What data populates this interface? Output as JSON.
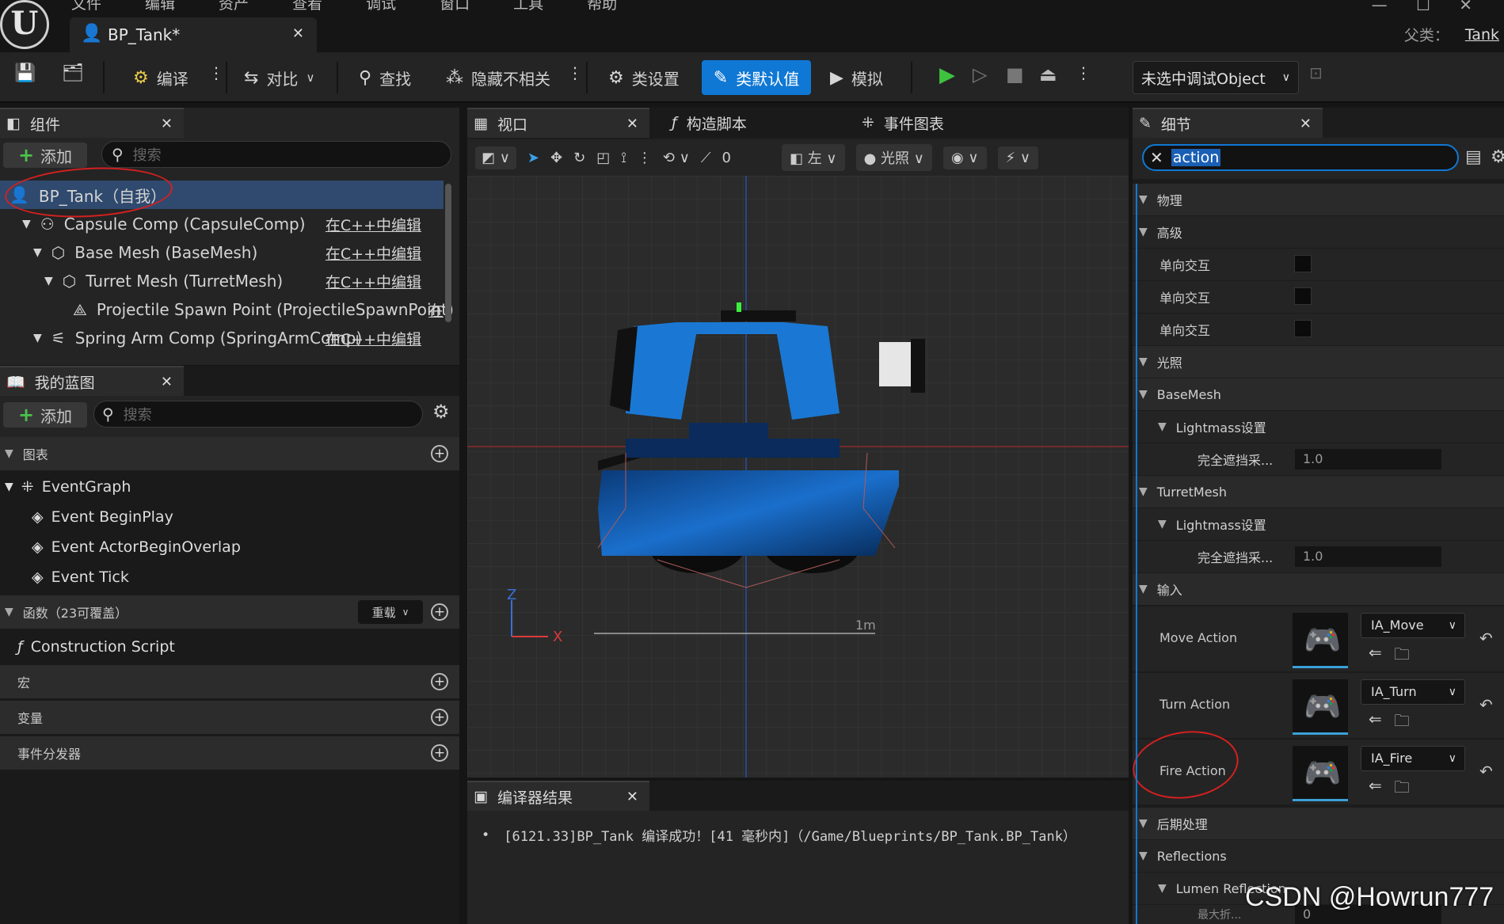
{
  "menu": [
    "文件",
    "编辑",
    "资产",
    "查看",
    "调试",
    "窗口",
    "工具",
    "帮助"
  ],
  "doc_tab": {
    "title": "BP_Tank*"
  },
  "parent": {
    "label": "父类：",
    "value": "Tank"
  },
  "toolbar": {
    "compile": "编译",
    "diff": "对比",
    "find": "查找",
    "hide_unrelated": "隐藏不相关",
    "class_settings": "类设置",
    "class_defaults": "类默认值",
    "simulate": "模拟",
    "debug_object": "未选中调试Object"
  },
  "components": {
    "tab": "组件",
    "add": "添加",
    "search_placeholder": "搜索",
    "tree": [
      {
        "label": "BP_Tank（自我）",
        "edit": ""
      },
      {
        "label": "Capsule Comp (CapsuleComp)",
        "edit": "在C++中编辑"
      },
      {
        "label": "Base Mesh (BaseMesh)",
        "edit": "在C++中编辑"
      },
      {
        "label": "Turret Mesh (TurretMesh)",
        "edit": "在C++中编辑"
      },
      {
        "label": "Projectile Spawn Point (ProjectileSpawnPoint)",
        "edit": "在"
      },
      {
        "label": "Spring Arm Comp (SpringArmComp)",
        "edit": "在C++中编辑"
      }
    ]
  },
  "my_blueprint": {
    "tab": "我的蓝图",
    "add": "添加",
    "search_placeholder": "搜索",
    "graphs_header": "图表",
    "event_graph": "EventGraph",
    "events": [
      "Event BeginPlay",
      "Event ActorBeginOverlap",
      "Event Tick"
    ],
    "functions_header": "函数（23可覆盖）",
    "override": "重载",
    "construction_script": "Construction Script",
    "macros_header": "宏",
    "variables_header": "变量",
    "dispatchers_header": "事件分发器"
  },
  "viewport": {
    "tabs": [
      "视口",
      "构造脚本",
      "事件图表"
    ],
    "snap_angle": "0",
    "view_mode": "左",
    "lighting": "光照",
    "axis_z": "Z",
    "axis_x": "X",
    "scale": "1m"
  },
  "compiler": {
    "tab": "编译器结果",
    "message": "[6121.33]BP_Tank 编译成功！[41 毫秒内]（/Game/Blueprints/BP_Tank.BP_Tank）"
  },
  "details": {
    "tab": "细节",
    "search_value": "action",
    "rows": {
      "physics": "物理",
      "advanced": "高级",
      "one_way": "单向交互",
      "lighting": "光照",
      "basemesh": "BaseMesh",
      "lightmass": "Lightmass设置",
      "full_occlusion": "完全遮挡采...",
      "occlusion_value": "1.0",
      "turretmesh": "TurretMesh",
      "input": "输入",
      "postprocess": "后期处理",
      "reflections": "Reflections",
      "lumen": "Lumen Reflection",
      "max_refl": "最大折...",
      "max_refl_value": "0"
    },
    "actions": [
      {
        "label": "Move Action",
        "asset": "IA_Move"
      },
      {
        "label": "Turn Action",
        "asset": "IA_Turn"
      },
      {
        "label": "Fire Action",
        "asset": "IA_Fire"
      }
    ]
  },
  "watermark": "CSDN @Howrun777",
  "colors": {
    "accent": "#0f78d4",
    "annotation": "#d42020",
    "selection": "#2f4a6e"
  }
}
